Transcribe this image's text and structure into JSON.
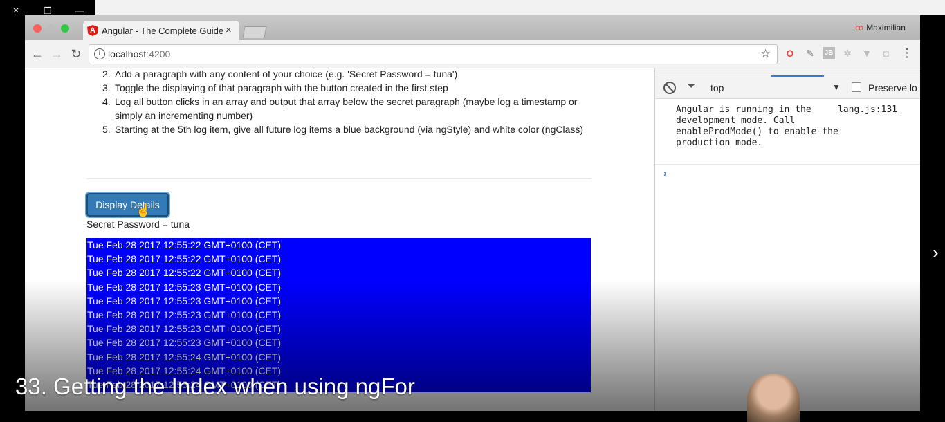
{
  "player": {
    "close_icon": "×",
    "restore_icon": "❐",
    "minimize_icon": "—",
    "next_icon": "›",
    "lecture_title": "33. Getting the Index when using ngFor"
  },
  "browser": {
    "tab_title": "Angular - The Complete Guide",
    "tab_close": "×",
    "profile_name": "Maximilian",
    "url_host": "localhost",
    "url_port": ":4200",
    "back_icon": "←",
    "forward_icon": "→",
    "reload_icon": "↻",
    "star_icon": "☆",
    "menu_icon": "⋮"
  },
  "page": {
    "steps": [
      {
        "num": "2.",
        "text": "Add a paragraph with any content of your choice (e.g. 'Secret Password = tuna')"
      },
      {
        "num": "3.",
        "text": "Toggle the displaying of that paragraph with the button created in the first step"
      },
      {
        "num": "4.",
        "text": "Log all button clicks in an array and output that array below the secret paragraph (maybe log a timestamp or simply an incrementing number)"
      },
      {
        "num": "5.",
        "text": "Starting at the 5th log item, give all future log items a blue background (via ngStyle) and white color (ngClass)"
      }
    ],
    "button_label": "Display Details",
    "secret_text": "Secret Password = tuna",
    "log_items": [
      "Tue Feb 28 2017 12:55:22 GMT+0100 (CET)",
      "Tue Feb 28 2017 12:55:22 GMT+0100 (CET)",
      "Tue Feb 28 2017 12:55:22 GMT+0100 (CET)",
      "Tue Feb 28 2017 12:55:23 GMT+0100 (CET)",
      "Tue Feb 28 2017 12:55:23 GMT+0100 (CET)",
      "Tue Feb 28 2017 12:55:23 GMT+0100 (CET)",
      "Tue Feb 28 2017 12:55:23 GMT+0100 (CET)",
      "Tue Feb 28 2017 12:55:23 GMT+0100 (CET)",
      "Tue Feb 28 2017 12:55:24 GMT+0100 (CET)",
      "Tue Feb 28 2017 12:55:24 GMT+0100 (CET)",
      "Tue Feb 28 2017 12:55:24 GMT+0100 (CET)"
    ]
  },
  "devtools": {
    "context": "top",
    "dropdown_icon": "▼",
    "preserve_label": "Preserve lo",
    "message": "Angular is running in the\ndevelopment mode. Call\nenableProdMode() to enable the\nproduction mode.",
    "source_link": "lang.js:131",
    "prompt_icon": "›"
  },
  "colors": {
    "log_background": "#0000ff",
    "button_primary": "#337ab7",
    "angular_red": "#dd1b16"
  }
}
